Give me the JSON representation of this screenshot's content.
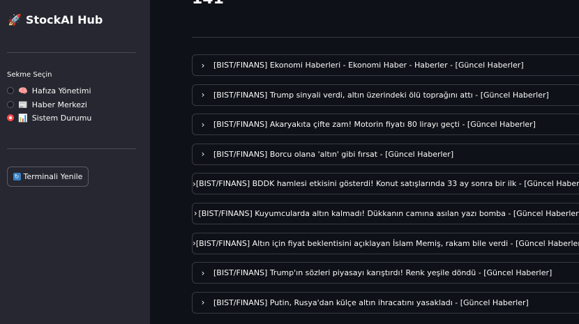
{
  "sidebar": {
    "brand_icon": "🚀",
    "brand": "StockAI Hub",
    "radio_label": "Sekme Seçin",
    "options": [
      {
        "icon": "🧠",
        "label": "Hafıza Yönetimi",
        "selected": false
      },
      {
        "icon": "📰",
        "label": "Haber Merkezi",
        "selected": false
      },
      {
        "icon": "📊",
        "label": "Sistem Durumu",
        "selected": true
      }
    ],
    "refresh_icon": "🔄",
    "refresh_label": "Terminali Yenile"
  },
  "main": {
    "count": "141",
    "news": [
      "[BIST/FINANS] Ekonomi Haberleri - Ekonomi Haber - Haberler - [Güncel Haberler]",
      "[BIST/FINANS] Trump sinyali verdi, altın üzerindeki ölü toprağını attı - [Güncel Haberler]",
      "[BIST/FINANS] Akaryakıta çifte zam! Motorin fiyatı 80 lirayı geçti - [Güncel Haberler]",
      "[BIST/FINANS] Borcu olana 'altın' gibi fırsat - [Güncel Haberler]",
      "[BIST/FINANS] BDDK hamlesi etkisini gösterdi! Konut satışlarında 33 ay sonra bir ilk - [Güncel Haberler]",
      "[BIST/FINANS] Kuyumcularda altın kalmadı! Dükkanın camına asılan yazı bomba - [Güncel Haberler]",
      "[BIST/FINANS] Altın için fiyat beklentisini açıklayan İslam Memiş, rakam bile verdi - [Güncel Haberler]",
      "[BIST/FINANS] Trump'ın sözleri piyasayı karıştırdı! Renk yeşile döndü - [Güncel Haberler]",
      "[BIST/FINANS] Putin, Rusya'dan külçe altın ihracatını yasakladı - [Güncel Haberler]"
    ]
  },
  "colors": {
    "background": "#0e1117",
    "sidebar": "#262730",
    "accent": "#ff4b4b"
  }
}
